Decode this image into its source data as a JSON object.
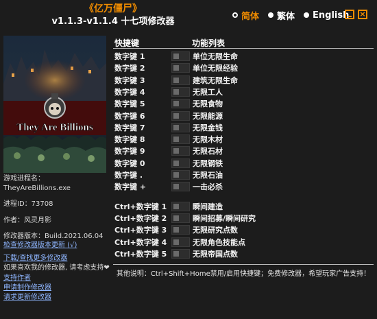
{
  "header": {
    "game_title": "《亿万僵尸》",
    "version_title": "v1.1.3-v1.1.4 十七项修改器"
  },
  "languages": [
    {
      "label": "简体",
      "selected": true
    },
    {
      "label": "繁体",
      "selected": false
    },
    {
      "label": "English",
      "selected": false
    }
  ],
  "window": {
    "minimize_icon": "minimize-icon",
    "close_icon": "close-icon",
    "close_glyph": "×"
  },
  "cover": {
    "title": "They Are Billions"
  },
  "info": {
    "process_label": "游戏进程名：",
    "process_name": "TheyAreBillions.exe",
    "process_id": "进程ID：73708",
    "author": "作者：风灵月影",
    "build": "修改器版本：Build.2021.06.04",
    "check_update": "检查修改器版本更新 (√)",
    "download_more": "下载/查找更多修改器",
    "support_text": "如果喜欢我的修改器, 请考虑支持❤",
    "support_author": "支持作者",
    "request_trainer": "申请制作修改器",
    "request_update": "请求更新修改器"
  },
  "table": {
    "col_hotkey": "快捷键",
    "col_function": "功能列表",
    "rows": [
      {
        "key": "数字键 1",
        "fn": "单位无限生命"
      },
      {
        "key": "数字键 2",
        "fn": "单位无限经验"
      },
      {
        "key": "数字键 3",
        "fn": "建筑无限生命"
      },
      {
        "key": "数字键 4",
        "fn": "无限工人"
      },
      {
        "key": "数字键 5",
        "fn": "无限食物"
      },
      {
        "key": "数字键 6",
        "fn": "无限能源"
      },
      {
        "key": "数字键 7",
        "fn": "无限金钱"
      },
      {
        "key": "数字键 8",
        "fn": "无限木材"
      },
      {
        "key": "数字键 9",
        "fn": "无限石材"
      },
      {
        "key": "数字键 0",
        "fn": "无限钢铁"
      },
      {
        "key": "数字键 .",
        "fn": "无限石油"
      },
      {
        "key": "数字键 +",
        "fn": "一击必杀"
      },
      {
        "key": "Ctrl+数字键 1",
        "fn": "瞬间建造"
      },
      {
        "key": "Ctrl+数字键 2",
        "fn": "瞬间招募/瞬间研究"
      },
      {
        "key": "Ctrl+数字键 3",
        "fn": "无限研究点数"
      },
      {
        "key": "Ctrl+数字键 4",
        "fn": "无限角色技能点"
      },
      {
        "key": "Ctrl+数字键 5",
        "fn": "无限帝国点数"
      }
    ]
  },
  "footer_note": "其他说明：Ctrl+Shift+Home禁用/启用快捷键；免费修改器，希望玩家广告支持！",
  "colors": {
    "accent": "#f08c00",
    "background": "#1c1c1c",
    "link": "#8fb6ff"
  }
}
